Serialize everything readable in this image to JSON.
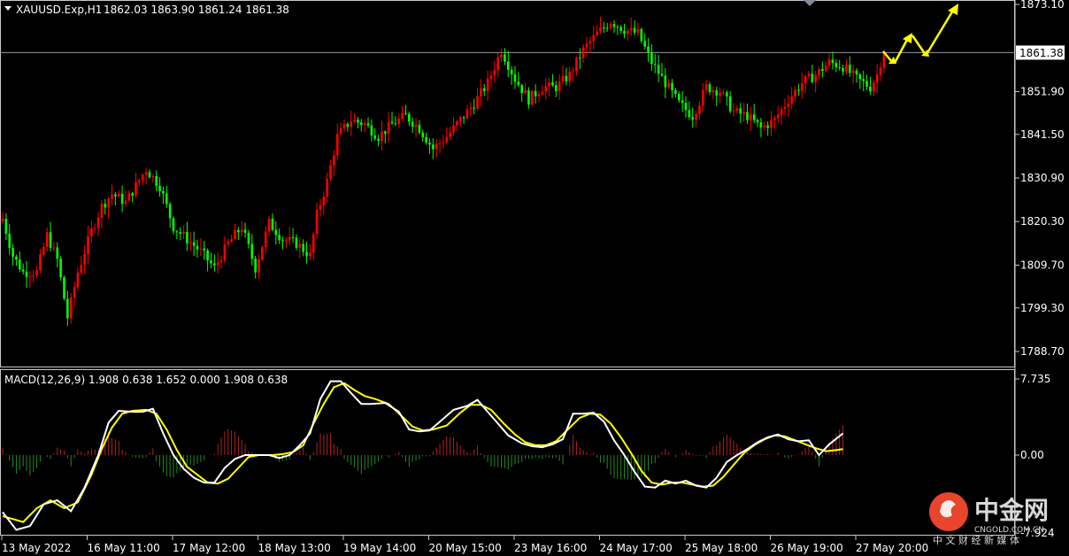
{
  "header": {
    "symbol": "XAUUSD.Exp,H1",
    "ohlc": "1862.03 1863.90 1861.24 1861.38"
  },
  "macd_header": {
    "label": "MACD(12,26,9) 1.908 0.638 1.652 0.000 1.908 0.638"
  },
  "current_price_label": "1861.38",
  "watermark": {
    "cn": "中金网",
    "en": "CNGOLD.COM.CN",
    "sub": "中 文 财 经 新 媒 体"
  },
  "colors": {
    "background": "#000000",
    "bull_candle": "#ff0000",
    "bear_candle": "#00ff00",
    "macd_line": "#ffffff",
    "signal_line": "#ffff00",
    "hist_pos": "#b22222",
    "hist_neg": "#228b22",
    "arrow": "#ffff00",
    "watermark_logo": "#e8452c"
  },
  "chart_data": [
    {
      "type": "candlestick",
      "title": "XAUUSD.Exp,H1",
      "ylim": [
        1785,
        1874
      ],
      "y_ticks": [
        {
          "value": 1873.1,
          "label": "1873.10"
        },
        {
          "value": 1851.9,
          "label": "1851.90"
        },
        {
          "value": 1841.5,
          "label": "1841.50"
        },
        {
          "value": 1830.9,
          "label": "1830.90"
        },
        {
          "value": 1820.3,
          "label": "1820.30"
        },
        {
          "value": 1809.7,
          "label": "1809.70"
        },
        {
          "value": 1799.3,
          "label": "1799.30"
        },
        {
          "value": 1788.7,
          "label": "1788.70"
        }
      ],
      "current_price": 1861.38,
      "x_labels": [
        "13 May 2022",
        "16 May 11:00",
        "17 May 12:00",
        "18 May 13:00",
        "19 May 14:00",
        "20 May 15:00",
        "23 May 16:00",
        "24 May 17:00",
        "25 May 18:00",
        "26 May 19:00",
        "27 May 20:00"
      ],
      "close_anchors": [
        [
          0,
          1821
        ],
        [
          3,
          1812
        ],
        [
          6,
          1808
        ],
        [
          10,
          1808
        ],
        [
          13,
          1817
        ],
        [
          16,
          1811
        ],
        [
          19,
          1797
        ],
        [
          22,
          1808
        ],
        [
          26,
          1818
        ],
        [
          29,
          1824
        ],
        [
          32,
          1827
        ],
        [
          36,
          1825
        ],
        [
          39,
          1829
        ],
        [
          42,
          1833
        ],
        [
          46,
          1829
        ],
        [
          50,
          1819
        ],
        [
          54,
          1816
        ],
        [
          58,
          1813
        ],
        [
          62,
          1809
        ],
        [
          66,
          1815
        ],
        [
          70,
          1819
        ],
        [
          74,
          1809
        ],
        [
          78,
          1820
        ],
        [
          82,
          1816
        ],
        [
          86,
          1815
        ],
        [
          90,
          1812
        ],
        [
          92,
          1822
        ],
        [
          95,
          1830
        ],
        [
          98,
          1841
        ],
        [
          102,
          1845
        ],
        [
          106,
          1844
        ],
        [
          110,
          1841
        ],
        [
          114,
          1844
        ],
        [
          118,
          1846
        ],
        [
          122,
          1843
        ],
        [
          126,
          1838
        ],
        [
          130,
          1841
        ],
        [
          134,
          1845
        ],
        [
          138,
          1849
        ],
        [
          142,
          1854
        ],
        [
          146,
          1862
        ],
        [
          150,
          1855
        ],
        [
          154,
          1850
        ],
        [
          158,
          1853
        ],
        [
          162,
          1853
        ],
        [
          166,
          1856
        ],
        [
          170,
          1862
        ],
        [
          174,
          1866
        ],
        [
          178,
          1869
        ],
        [
          182,
          1867
        ],
        [
          186,
          1866
        ],
        [
          190,
          1859
        ],
        [
          194,
          1854
        ],
        [
          198,
          1849
        ],
        [
          202,
          1846
        ],
        [
          206,
          1853
        ],
        [
          210,
          1852
        ],
        [
          214,
          1847
        ],
        [
          218,
          1846
        ],
        [
          222,
          1843
        ],
        [
          226,
          1845
        ],
        [
          230,
          1850
        ],
        [
          234,
          1854
        ],
        [
          238,
          1856
        ],
        [
          242,
          1859
        ],
        [
          246,
          1858
        ],
        [
          250,
          1855
        ],
        [
          254,
          1853
        ],
        [
          256,
          1856
        ],
        [
          258,
          1862
        ]
      ],
      "y_tick_color": "#ffffff"
    },
    {
      "type": "macd",
      "title": "MACD(12,26,9) 1.908 0.638 1.652 0.000 1.908 0.638",
      "ylim": [
        -9.5,
        7.735
      ],
      "y_ticks": [
        {
          "value": 7.735,
          "label": "7.735"
        },
        {
          "value": 0.0,
          "label": "0.00"
        },
        {
          "value": -7.924,
          "label": "-7.924"
        }
      ],
      "series": [
        {
          "name": "MACD",
          "points": [
            [
              0,
              -5.8
            ],
            [
              4,
              -7.6
            ],
            [
              8,
              -7.2
            ],
            [
              12,
              -5.0
            ],
            [
              16,
              -4.6
            ],
            [
              20,
              -5.7
            ],
            [
              24,
              -3.3
            ],
            [
              28,
              0.0
            ],
            [
              31,
              3.3
            ],
            [
              34,
              4.5
            ],
            [
              38,
              4.4
            ],
            [
              41,
              4.4
            ],
            [
              44,
              4.7
            ],
            [
              47,
              2.2
            ],
            [
              50,
              0.0
            ],
            [
              53,
              -1.4
            ],
            [
              56,
              -2.3
            ],
            [
              59,
              -2.8
            ],
            [
              62,
              -2.8
            ],
            [
              65,
              -1.3
            ],
            [
              68,
              -0.4
            ],
            [
              71,
              0.0
            ],
            [
              74,
              0.0
            ],
            [
              78,
              0.0
            ],
            [
              81,
              -0.3
            ],
            [
              84,
              0.0
            ],
            [
              87,
              1.0
            ],
            [
              90,
              2.2
            ],
            [
              93,
              5.7
            ],
            [
              96,
              7.5
            ],
            [
              99,
              7.5
            ],
            [
              102,
              6.3
            ],
            [
              105,
              5.2
            ],
            [
              108,
              5.2
            ],
            [
              112,
              5.3
            ],
            [
              116,
              4.4
            ],
            [
              119,
              2.6
            ],
            [
              122,
              2.4
            ],
            [
              125,
              2.5
            ],
            [
              128,
              3.4
            ],
            [
              132,
              4.6
            ],
            [
              136,
              5.0
            ],
            [
              139,
              5.6
            ],
            [
              142,
              4.4
            ],
            [
              145,
              3.2
            ],
            [
              148,
              2.0
            ],
            [
              152,
              1.2
            ],
            [
              155,
              0.9
            ],
            [
              158,
              0.8
            ],
            [
              161,
              1.1
            ],
            [
              164,
              1.6
            ],
            [
              167,
              4.2
            ],
            [
              170,
              4.2
            ],
            [
              173,
              4.3
            ],
            [
              176,
              3.4
            ],
            [
              179,
              1.5
            ],
            [
              182,
              0.0
            ],
            [
              185,
              -1.7
            ],
            [
              188,
              -3.2
            ],
            [
              191,
              -3.3
            ],
            [
              194,
              -2.6
            ],
            [
              197,
              -2.9
            ],
            [
              200,
              -2.6
            ],
            [
              203,
              -3.1
            ],
            [
              206,
              -3.3
            ],
            [
              209,
              -2.3
            ],
            [
              212,
              -0.7
            ],
            [
              215,
              0.0
            ],
            [
              218,
              0.6
            ],
            [
              221,
              1.3
            ],
            [
              224,
              1.8
            ],
            [
              227,
              2.1
            ],
            [
              230,
              1.6
            ],
            [
              233,
              1.4
            ],
            [
              236,
              1.5
            ],
            [
              239,
              0.0
            ],
            [
              242,
              1.1
            ],
            [
              246,
              2.2
            ]
          ]
        },
        {
          "name": "Signal",
          "points": [
            [
              0,
              -6.2
            ],
            [
              6,
              -6.8
            ],
            [
              10,
              -5.4
            ],
            [
              14,
              -4.6
            ],
            [
              18,
              -5.4
            ],
            [
              22,
              -4.8
            ],
            [
              26,
              -2.0
            ],
            [
              29,
              0.6
            ],
            [
              32,
              2.8
            ],
            [
              35,
              4.2
            ],
            [
              38,
              4.5
            ],
            [
              42,
              4.6
            ],
            [
              45,
              4.2
            ],
            [
              48,
              2.6
            ],
            [
              51,
              0.5
            ],
            [
              54,
              -1.2
            ],
            [
              57,
              -2.0
            ],
            [
              60,
              -2.8
            ],
            [
              63,
              -2.9
            ],
            [
              66,
              -2.4
            ],
            [
              69,
              -1.3
            ],
            [
              72,
              -0.2
            ],
            [
              75,
              0.0
            ],
            [
              79,
              0.0
            ],
            [
              82,
              0.1
            ],
            [
              85,
              0.3
            ],
            [
              88,
              1.0
            ],
            [
              91,
              3.2
            ],
            [
              94,
              5.2
            ],
            [
              97,
              6.9
            ],
            [
              100,
              7.3
            ],
            [
              103,
              6.6
            ],
            [
              106,
              6.0
            ],
            [
              109,
              5.7
            ],
            [
              113,
              5.2
            ],
            [
              117,
              3.9
            ],
            [
              120,
              2.9
            ],
            [
              123,
              2.5
            ],
            [
              126,
              2.6
            ],
            [
              130,
              3.0
            ],
            [
              134,
              4.3
            ],
            [
              137,
              5.1
            ],
            [
              140,
              5.1
            ],
            [
              143,
              4.6
            ],
            [
              147,
              3.1
            ],
            [
              150,
              2.1
            ],
            [
              153,
              1.3
            ],
            [
              156,
              1.0
            ],
            [
              159,
              1.0
            ],
            [
              162,
              1.4
            ],
            [
              166,
              2.8
            ],
            [
              169,
              3.8
            ],
            [
              172,
              4.2
            ],
            [
              175,
              4.1
            ],
            [
              178,
              3.2
            ],
            [
              181,
              1.8
            ],
            [
              184,
              0.2
            ],
            [
              187,
              -1.6
            ],
            [
              190,
              -2.8
            ],
            [
              193,
              -3.0
            ],
            [
              196,
              -2.8
            ],
            [
              199,
              -2.8
            ],
            [
              202,
              -3.0
            ],
            [
              205,
              -3.2
            ],
            [
              208,
              -3.1
            ],
            [
              211,
              -2.2
            ],
            [
              214,
              -1.0
            ],
            [
              217,
              0.2
            ],
            [
              220,
              1.0
            ],
            [
              223,
              1.6
            ],
            [
              226,
              2.0
            ],
            [
              229,
              1.9
            ],
            [
              232,
              1.5
            ],
            [
              235,
              1.1
            ],
            [
              238,
              0.7
            ],
            [
              241,
              0.4
            ],
            [
              244,
              0.5
            ],
            [
              246,
              0.6
            ]
          ]
        }
      ]
    }
  ]
}
